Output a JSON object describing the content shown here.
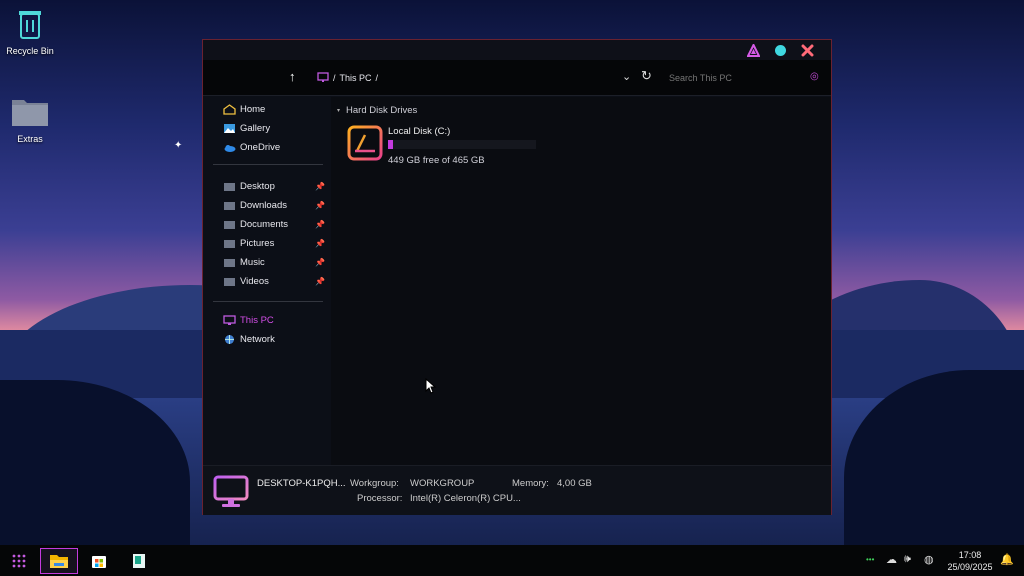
{
  "desktop": {
    "icons": [
      {
        "label": "Recycle Bin",
        "icon": "recycle-bin-icon"
      },
      {
        "label": "Extras",
        "icon": "folder-icon"
      }
    ]
  },
  "window": {
    "address": {
      "location": "This PC",
      "separator": "/"
    },
    "search_placeholder": "Search This PC",
    "sidebar": {
      "quick": [
        {
          "label": "Home",
          "icon": "home-icon"
        },
        {
          "label": "Gallery",
          "icon": "gallery-icon"
        },
        {
          "label": "OneDrive",
          "icon": "onedrive-icon"
        }
      ],
      "pinned": [
        {
          "label": "Desktop",
          "icon": "folder-icon"
        },
        {
          "label": "Downloads",
          "icon": "folder-icon"
        },
        {
          "label": "Documents",
          "icon": "folder-icon"
        },
        {
          "label": "Pictures",
          "icon": "folder-icon"
        },
        {
          "label": "Music",
          "icon": "folder-icon"
        },
        {
          "label": "Videos",
          "icon": "folder-icon"
        }
      ],
      "locations": [
        {
          "label": "This PC",
          "icon": "monitor-icon",
          "selected": true
        },
        {
          "label": "Network",
          "icon": "network-icon"
        }
      ]
    },
    "group_header": "Hard Disk Drives",
    "drives": [
      {
        "name": "Local Disk (C:)",
        "free_text": "449 GB free of 465 GB",
        "used_fraction": 0.035
      }
    ],
    "details": {
      "pc_name": "DESKTOP-K1PQH...",
      "workgroup_label": "Workgroup:",
      "workgroup_value": "WORKGROUP",
      "memory_label": "Memory:",
      "memory_value": "4,00 GB",
      "processor_label": "Processor:",
      "processor_value": "Intel(R) Celeron(R) CPU..."
    }
  },
  "taskbar": {
    "apps": [
      "start-grid-icon",
      "file-explorer-icon",
      "store-icon",
      "notepad-icon"
    ],
    "clock_time": "17:08",
    "clock_date": "25/09/2025"
  },
  "colors": {
    "accent": "#c43bde",
    "selected_text": "#d24ee6",
    "window_border": "#6a2230"
  }
}
